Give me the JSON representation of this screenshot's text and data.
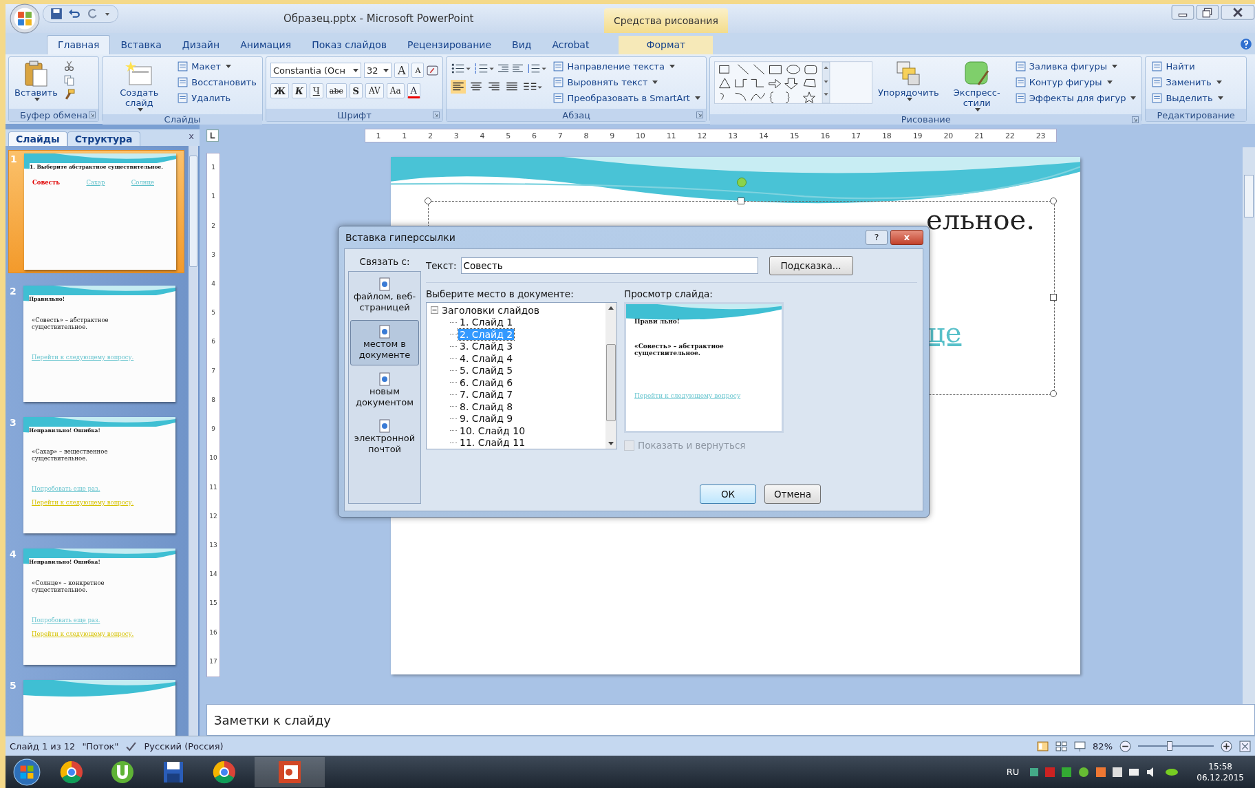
{
  "window": {
    "title": "Образец.pptx - Microsoft PowerPoint",
    "context_group": "Средства рисования"
  },
  "ribbon_tabs": [
    {
      "label": "Главная",
      "selected": true
    },
    {
      "label": "Вставка",
      "selected": false
    },
    {
      "label": "Дизайн",
      "selected": false
    },
    {
      "label": "Анимация",
      "selected": false
    },
    {
      "label": "Показ слайдов",
      "selected": false
    },
    {
      "label": "Рецензирование",
      "selected": false
    },
    {
      "label": "Вид",
      "selected": false
    },
    {
      "label": "Acrobat",
      "selected": false
    },
    {
      "label": "Формат",
      "selected": false,
      "context": true
    }
  ],
  "ribbon_groups": [
    {
      "kind": "buttons",
      "label": "Буфер обмена",
      "launcher": true,
      "large": [
        {
          "label": "Вставить",
          "kind": "paste",
          "dropdown": true
        }
      ]
    },
    {
      "kind": "buttons",
      "label": "Слайды",
      "launcher": false,
      "large": [
        {
          "label": "Создать слайд",
          "kind": "slide",
          "dropdown": true
        }
      ],
      "small": [
        {
          "label": "Макет",
          "dropdown": true
        },
        {
          "label": "Восстановить",
          "dropdown": false
        },
        {
          "label": "Удалить",
          "dropdown": false
        }
      ]
    },
    {
      "kind": "font",
      "label": "Шрифт",
      "launcher": true,
      "font": "Constantia (Осн",
      "size": "32",
      "size_buttons": [
        "A",
        "A"
      ],
      "format_buttons": [
        {
          "text": "Ж",
          "kind": "bold"
        },
        {
          "text": "К",
          "kind": "italic"
        },
        {
          "text": "Ч",
          "kind": "underline"
        },
        {
          "text": "abc",
          "kind": "strike"
        },
        {
          "text": "S",
          "kind": "shadow"
        },
        {
          "text": "AV",
          "kind": "spacing"
        },
        {
          "text": "Aa",
          "kind": "case"
        },
        {
          "text": "A",
          "kind": "color"
        }
      ]
    },
    {
      "kind": "paragraph",
      "label": "Абзац",
      "launcher": true,
      "alignments": [
        {
          "selected": true
        },
        {
          "selected": false
        },
        {
          "selected": false
        },
        {
          "selected": false
        }
      ],
      "small": [
        {
          "label": "Направление текста",
          "dropdown": true
        },
        {
          "label": "Выровнять текст",
          "dropdown": true
        },
        {
          "label": "Преобразовать в SmartArt",
          "dropdown": true
        }
      ]
    },
    {
      "kind": "drawing",
      "label": "Рисование",
      "launcher": true,
      "large": [
        {
          "label": "Упорядочить",
          "kind": "arrange",
          "dropdown": true
        },
        {
          "label": "Экспресс-стили",
          "kind": "styles",
          "dropdown": true
        }
      ],
      "small": [
        {
          "label": "Заливка фигуры",
          "dropdown": true
        },
        {
          "label": "Контур фигуры",
          "dropdown": true
        },
        {
          "label": "Эффекты для фигур",
          "dropdown": true
        }
      ]
    },
    {
      "kind": "buttons",
      "label": "Редактирование",
      "launcher": false,
      "small": [
        {
          "label": "Найти",
          "dropdown": false
        },
        {
          "label": "Заменить",
          "dropdown": true
        },
        {
          "label": "Выделить",
          "dropdown": true
        }
      ]
    }
  ],
  "side_panel": {
    "tabs": [
      {
        "label": "Слайды",
        "selected": true
      },
      {
        "label": "Структура",
        "selected": false
      }
    ],
    "close": "x",
    "thumbnails": [
      {
        "number": "1",
        "selected": true,
        "title": "1. Выберите абстрактное существительное.",
        "choices": [
          {
            "text": "Совесть",
            "kind": "chosen"
          },
          {
            "text": "Сахар",
            "kind": "link"
          },
          {
            "text": "Солнце",
            "kind": "link"
          }
        ]
      },
      {
        "number": "2",
        "selected": false,
        "title": "Правильно!",
        "body": "«Совесть» – абстрактное существительное.",
        "links": [
          {
            "text": "Перейти к следующему вопросу.",
            "kind": "link"
          }
        ]
      },
      {
        "number": "3",
        "selected": false,
        "title": "Неправильно!  Ошибка!",
        "body": "«Сахар» – вещественное существительное.",
        "links": [
          {
            "text": "Попробовать еще раз.",
            "kind": "link"
          },
          {
            "text": "Перейти к следующему вопросу.",
            "kind": "visited"
          }
        ]
      },
      {
        "number": "4",
        "selected": false,
        "title": "Неправильно!  Ошибка!",
        "body": "«Солнце» – конкретное существительное.",
        "links": [
          {
            "text": "Попробовать еще раз.",
            "kind": "link"
          },
          {
            "text": "Перейти к следующему вопросу.",
            "kind": "visited"
          }
        ]
      },
      {
        "number": "5",
        "selected": false
      }
    ]
  },
  "ruler": {
    "horizontal": [
      "1",
      "1",
      "2",
      "3",
      "4",
      "5",
      "6",
      "7",
      "8",
      "9",
      "10",
      "11",
      "12",
      "13",
      "14",
      "15",
      "16",
      "17",
      "18",
      "19",
      "20",
      "21",
      "22",
      "23"
    ],
    "vertical": [
      "1",
      "1",
      "2",
      "3",
      "4",
      "5",
      "6",
      "7",
      "8",
      "9",
      "10",
      "11",
      "12",
      "13",
      "14",
      "15",
      "16",
      "17"
    ]
  },
  "slide": {
    "title_visible": "ельное.",
    "link_visible": "це"
  },
  "notes": {
    "placeholder": "Заметки к слайду"
  },
  "dialog": {
    "title": "Вставка гиперссылки",
    "help": "?",
    "close": "x",
    "link_to_label": "Связать с:",
    "link_targets": [
      {
        "label": "файлом, веб-страницей",
        "selected": false
      },
      {
        "label": "местом в документе",
        "selected": true
      },
      {
        "label": "новым документом",
        "selected": false
      },
      {
        "label": "электронной почтой",
        "selected": false
      }
    ],
    "text_label": "Текст:",
    "text_value": "Совесть",
    "hint_button": "Подсказка...",
    "place_label": "Выберите место в документе:",
    "tree": {
      "label": "Заголовки слайдов",
      "expanded": true,
      "children": [
        {
          "label": "1. Слайд 1",
          "selected": false
        },
        {
          "label": "2. Слайд 2",
          "selected": true
        },
        {
          "label": "3. Слайд 3",
          "selected": false
        },
        {
          "label": "4. Слайд 4",
          "selected": false
        },
        {
          "label": "5. Слайд 5",
          "selected": false
        },
        {
          "label": "6. Слайд 6",
          "selected": false
        },
        {
          "label": "7. Слайд 7",
          "selected": false
        },
        {
          "label": "8. Слайд 8",
          "selected": false
        },
        {
          "label": "9. Слайд 9",
          "selected": false
        },
        {
          "label": "10. Слайд 10",
          "selected": false
        },
        {
          "label": "11. Слайд 11",
          "selected": false
        }
      ]
    },
    "preview_label": "Просмотр слайда:",
    "preview": {
      "title": "Прави льно!",
      "body": "«Совесть» – абстрактное существительное.",
      "link": "Перейти к следующему  вопросу"
    },
    "show_and_return": {
      "label": "Показать и вернуться",
      "checked": false,
      "disabled": true
    },
    "buttons": [
      "ОК",
      "Отмена"
    ]
  },
  "status_bar": {
    "slide": "Слайд 1 из 12",
    "theme": "\"Поток\"",
    "language": "Русский (Россия)",
    "zoom": "82%",
    "zoom_slider": {
      "level": 0.42
    }
  },
  "taskbar": {
    "language": "RU",
    "time": "15:58",
    "date": "06.12.2015"
  }
}
